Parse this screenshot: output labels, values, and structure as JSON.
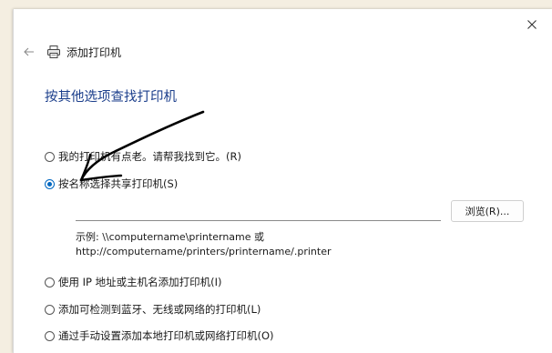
{
  "window": {
    "title": "添加打印机",
    "heading": "按其他选项查找打印机"
  },
  "options": [
    {
      "label": "我的打印机有点老。请帮我找到它。(R)",
      "checked": false
    },
    {
      "label": "按名称选择共享打印机(S)",
      "checked": true
    },
    {
      "label": "使用 IP 地址或主机名添加打印机(I)",
      "checked": false
    },
    {
      "label": "添加可检测到蓝牙、无线或网络的打印机(L)",
      "checked": false
    },
    {
      "label": "通过手动设置添加本地打印机或网络打印机(O)",
      "checked": false
    }
  ],
  "shared_printer": {
    "input_value": "",
    "browse_label": "浏览(R)...",
    "example_line1": "示例: \\\\computername\\printername 或",
    "example_line2": "http://computername/printers/printername/.printer"
  },
  "icons": {
    "close": "close-icon",
    "back": "back-arrow-icon",
    "printer": "printer-icon"
  },
  "colors": {
    "heading": "#1c3f8c",
    "radio_selected": "#0067c0",
    "background": "#f4eee1"
  }
}
